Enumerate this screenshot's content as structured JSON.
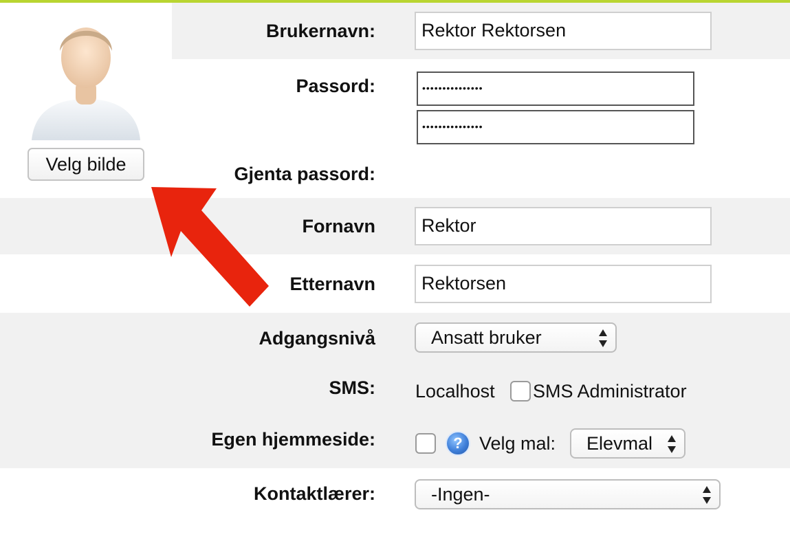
{
  "avatar": {
    "choose_image_label": "Velg bilde"
  },
  "form": {
    "username": {
      "label": "Brukernavn:",
      "value": "Rektor Rektorsen"
    },
    "password": {
      "label": "Passord:",
      "masked_value": "•••••••••••••••"
    },
    "repeat_password": {
      "label": "Gjenta passord:",
      "masked_value": "•••••••••••••••"
    },
    "first_name": {
      "label": "Fornavn",
      "value": "Rektor"
    },
    "last_name": {
      "label": "Etternavn",
      "value": "Rektorsen"
    },
    "access_level": {
      "label": "Adgangsnivå",
      "selected": "Ansatt bruker"
    },
    "sms": {
      "label": "SMS:",
      "provider": "Localhost",
      "admin_label": "SMS Administrator",
      "admin_checked": false
    },
    "homepage": {
      "label": "Egen hjemmeside:",
      "checked": false,
      "help_icon": "help-icon",
      "template_label": "Velg mal:",
      "template_selected": "Elevmal"
    },
    "contact_teacher": {
      "label": "Kontaktlærer:",
      "selected": "-Ingen-"
    }
  },
  "annotation": {
    "arrow_color": "#e8240d",
    "icon": "arrow-up-left-icon"
  },
  "colors": {
    "accent_line": "#b9d531",
    "row_background": "#f1f1f1"
  }
}
